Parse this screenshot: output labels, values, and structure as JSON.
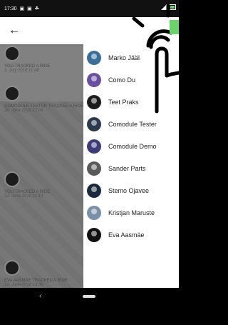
{
  "status_bar": {
    "time": "17:30",
    "icons": "▣ ▣ ☘"
  },
  "app_bar": {
    "back_icon": "←"
  },
  "feed": [
    {
      "title": "YOU tracked a ride",
      "date": "3. July 2018 11:48"
    },
    {
      "title": "COMODULE TESTER tracked a ride",
      "date": "28. June 2018 17:04"
    },
    {
      "title": "YOU tracked a ride",
      "date": "22. June 2018 11:10"
    },
    {
      "title": "EVA AASMÄE tracked a ride",
      "date": "13. June 2018 13:39"
    }
  ],
  "users": [
    {
      "name": "Marko Jääl",
      "color": "#3a6e9a"
    },
    {
      "name": "Como Du",
      "color": "#6a4fa0"
    },
    {
      "name": "Teet Praks",
      "color": "#1c1c1c"
    },
    {
      "name": "Comodule Tester",
      "color": "#2c3a4e"
    },
    {
      "name": "Comodule Demo",
      "color": "#3d3b7a"
    },
    {
      "name": "Sander Parts",
      "color": "#5a5a5a"
    },
    {
      "name": "Stemo Ojavee",
      "color": "#1a2a3a"
    },
    {
      "name": "Kristjan Maruste",
      "color": "#7a8fa8"
    },
    {
      "name": "Eva Aasmäe",
      "color": "#111111"
    }
  ],
  "nav": {
    "back_icon": "‹"
  }
}
